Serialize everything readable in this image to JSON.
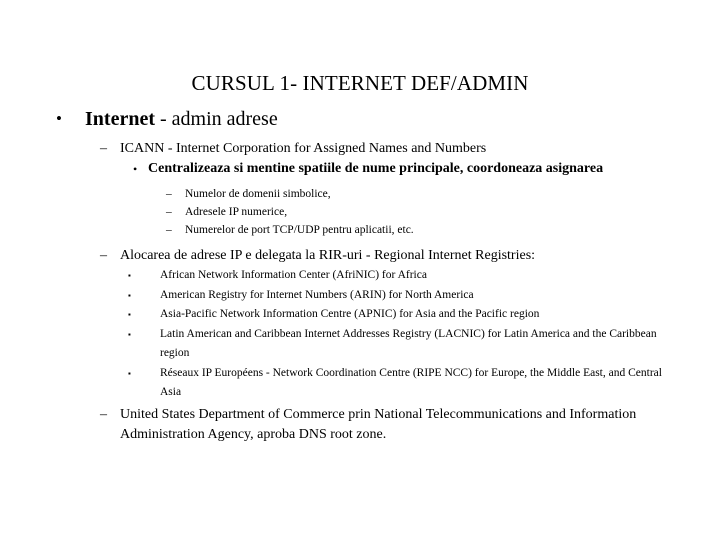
{
  "slide": {
    "title": "CURSUL 1- INTERNET DEF/ADMIN",
    "background_color": "#ffffff",
    "text_color": "#000000",
    "bullets": {
      "round": "•",
      "dash": "–",
      "square": "▪"
    },
    "level1": {
      "strong_text": "Internet",
      "rest_text": " - admin adrese"
    },
    "icann": {
      "text": "ICANN - Internet Corporation for Assigned Names and Numbers",
      "sub_bullet": "Centralizeaza si mentine spatiile de nume principale, coordoneaza asignarea",
      "details": [
        "Numelor de domenii simbolice,",
        "Adresele IP numerice,",
        "Numerelor de port TCP/UDP pentru aplicatii, etc."
      ]
    },
    "allocation": {
      "heading": "Alocarea de adrese IP e delegata la RIR-uri - Regional Internet Registries:",
      "registries": [
        "African Network Information Center (AfriNIC) for Africa",
        "American Registry for Internet Numbers (ARIN) for North America",
        "Asia-Pacific Network Information Centre (APNIC) for Asia and the Pacific region",
        "Latin American and Caribbean Internet Addresses Registry (LACNIC) for Latin America and the Caribbean region",
        "Réseaux IP Européens - Network Coordination Centre (RIPE NCC) for Europe, the Middle East, and Central Asia"
      ]
    },
    "usdoc": {
      "text": "United States Department of Commerce  prin  National Telecommunications and Information Administration Agency, aproba DNS root zone."
    }
  }
}
